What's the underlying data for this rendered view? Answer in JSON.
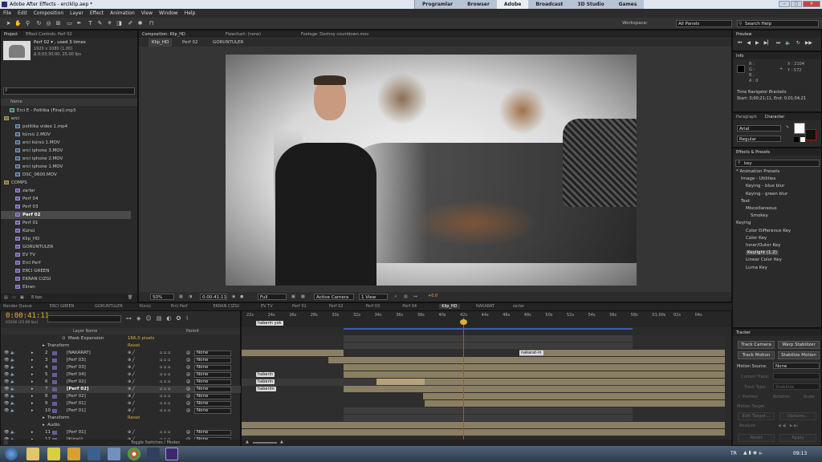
{
  "window": {
    "title": "Adobe After Effects - erciklip.aep *"
  },
  "topnav": [
    "Programlar",
    "Browser",
    "Adobe",
    "Broadcast",
    "3D Studio",
    "Games"
  ],
  "topnav_active": "Adobe",
  "menu": [
    "File",
    "Edit",
    "Composition",
    "Layer",
    "Effect",
    "Animation",
    "View",
    "Window",
    "Help"
  ],
  "toolbar": {
    "workspace_label": "Workspace:",
    "workspace_value": "All Panels",
    "search_placeholder": "Search Help"
  },
  "project": {
    "tabs": [
      "Project",
      "Effect Controls: Perf 02"
    ],
    "item_name": "Perf 02 ▾ , used 3 times",
    "item_info1": "1920 x 1080 (1,00)",
    "item_info2": "Δ 0;03;30;00, 25,00 fps",
    "col_name": "Name",
    "items": [
      {
        "label": "Erci E - Politika (Final).mp3",
        "type": "aud",
        "indent": 1
      },
      {
        "label": "erci",
        "type": "folder",
        "indent": 0
      },
      {
        "label": "politika video 1.mp4",
        "type": "vid",
        "indent": 2
      },
      {
        "label": "kürsü 2.MOV",
        "type": "vid",
        "indent": 2
      },
      {
        "label": "erci kürsü 1.MOV",
        "type": "vid",
        "indent": 2
      },
      {
        "label": "erci iphone 3.MOV",
        "type": "vid",
        "indent": 2
      },
      {
        "label": "erci iphone 2.MOV",
        "type": "vid",
        "indent": 2
      },
      {
        "label": "erci iphone 1.MOV",
        "type": "vid",
        "indent": 2
      },
      {
        "label": "DSC_0600.MOV",
        "type": "vid",
        "indent": 2
      },
      {
        "label": "COMPS",
        "type": "folder",
        "indent": 0
      },
      {
        "label": "zarlar",
        "type": "comp",
        "indent": 2
      },
      {
        "label": "Perf 04",
        "type": "comp",
        "indent": 2
      },
      {
        "label": "Perf 03",
        "type": "comp",
        "indent": 2
      },
      {
        "label": "Perf 02",
        "type": "comp",
        "indent": 2,
        "selected": true
      },
      {
        "label": "Perf 01",
        "type": "comp",
        "indent": 2
      },
      {
        "label": "Kürsü",
        "type": "comp",
        "indent": 2
      },
      {
        "label": "Klip_HD",
        "type": "comp",
        "indent": 2
      },
      {
        "label": "GORUNTULER",
        "type": "comp",
        "indent": 2
      },
      {
        "label": "EV TV",
        "type": "comp",
        "indent": 2
      },
      {
        "label": "Erci Perf",
        "type": "comp",
        "indent": 2
      },
      {
        "label": "ERCI GREEN",
        "type": "comp",
        "indent": 2
      },
      {
        "label": "EKRAN CIZGI",
        "type": "comp",
        "indent": 2
      },
      {
        "label": "Ekran",
        "type": "comp",
        "indent": 2
      }
    ],
    "bpc": "8 bpc"
  },
  "composition": {
    "tabs": [
      "Composition: Klip_HD",
      "Flowchart: (none)",
      "Footage: Destroy countdown.mov"
    ],
    "breadcrumbs": [
      "Klip_HD",
      "Perf 02",
      "GORUNTULER"
    ],
    "footer": {
      "zoom": "50%",
      "timecode": "0:00:41:11",
      "resolution": "Full",
      "camera": "Active Camera",
      "views": "1 View",
      "exposure": "+0,0"
    }
  },
  "info": {
    "tab": "Info",
    "r": "R :",
    "g": "G :",
    "b": "B :",
    "a": "A : 0",
    "x": "X : 2104",
    "y": "Y : 572",
    "tnb_label": "Time Navigator Brackets",
    "tnb_value": "Start: 0;00;21;11, End: 0;01;04;21"
  },
  "preview": {
    "tab": "Preview"
  },
  "character": {
    "tabs": [
      "Paragraph",
      "Character"
    ],
    "font": "Arial",
    "style": "Regular"
  },
  "effects": {
    "tab": "Effects & Presets",
    "search": "key",
    "items": [
      {
        "label": "* Animation Presets",
        "indent": 0
      },
      {
        "label": "Image - Utilities",
        "indent": 1
      },
      {
        "label": "Keying - blue blur",
        "indent": 2
      },
      {
        "label": "Keying - green blur",
        "indent": 2
      },
      {
        "label": "Text",
        "indent": 1
      },
      {
        "label": "Miscellaneous",
        "indent": 2
      },
      {
        "label": "Smokey",
        "indent": 3
      },
      {
        "label": "Keying",
        "indent": 0
      },
      {
        "label": "Color Difference Key",
        "indent": 2
      },
      {
        "label": "Color Key",
        "indent": 2
      },
      {
        "label": "Inner/Outer Key",
        "indent": 2
      },
      {
        "label": "Keylight (1.2)",
        "indent": 2,
        "selected": true
      },
      {
        "label": "Linear Color Key",
        "indent": 2
      },
      {
        "label": "Luma Key",
        "indent": 2
      }
    ]
  },
  "tracker": {
    "tab": "Tracker",
    "track_camera": "Track Camera",
    "warp_stabilizer": "Warp Stabilizer",
    "track_motion": "Track Motion",
    "stabilize_motion": "Stabilize Motion",
    "motion_source_label": "Motion Source:",
    "motion_source": "None",
    "current_track": "Current Track:",
    "track_type": "Track Type:",
    "track_type_value": "Stabilize",
    "position": "✓ Position",
    "rotation": "Rotation",
    "scale": "Scale",
    "motion_target": "Motion Target:",
    "edit_target": "Edit Target...",
    "options": "Options...",
    "analyze": "Analyze:",
    "reset": "Reset",
    "apply": "Apply"
  },
  "timeline": {
    "tabs": [
      "Render Queue",
      "ERCI GREEN",
      "GORUNTULER",
      "Kürsü",
      "Erci Perf",
      "EKRAN CIZGI",
      "EV TV",
      "Perf 01",
      "Perf 02",
      "Perf 03",
      "Perf 04",
      "Klip_HD",
      "NAKARAT",
      "zarlar"
    ],
    "active_tab": "Klip_HD",
    "timecode": "0:00:41:11",
    "timecode_sub": "01036 (25.00 fps)",
    "col_layer": "Layer Name",
    "col_parent": "Parent",
    "mask_expansion_label": "Mask Expansion",
    "mask_expansion_value": "166,0 pixels",
    "transform": "Transform",
    "reset": "Reset",
    "audio": "Audio",
    "toggle": "Toggle Switches / Modes",
    "ruler": [
      "22s",
      "24s",
      "26s",
      "28s",
      "30s",
      "32s",
      "34s",
      "36s",
      "38s",
      "40s",
      "42s",
      "44s",
      "46s",
      "48s",
      "50s",
      "52s",
      "54s",
      "56s",
      "58s",
      "01:00s",
      "02s",
      "04s"
    ],
    "layers": [
      {
        "num": "2",
        "name": "[NAKARAT]",
        "parent": "None"
      },
      {
        "num": "3",
        "name": "[Perf 03]",
        "parent": "None"
      },
      {
        "num": "4",
        "name": "[Perf 03]",
        "parent": "None"
      },
      {
        "num": "5",
        "name": "[Perf 04]",
        "parent": "None"
      },
      {
        "num": "6",
        "name": "[Perf 02]",
        "parent": "None"
      },
      {
        "num": "7",
        "name": "[Perf 02]",
        "parent": "None",
        "selected": true
      },
      {
        "num": "8",
        "name": "[Perf 02]",
        "parent": "None"
      },
      {
        "num": "9",
        "name": "[Perf 01]",
        "parent": "None"
      },
      {
        "num": "10",
        "name": "[Perf 01]",
        "parent": "None"
      },
      {
        "num": "11",
        "name": "[Perf 01]",
        "parent": "None"
      },
      {
        "num": "12",
        "name": "[Kürsü]",
        "parent": "None"
      }
    ],
    "markers": [
      "haberin yok",
      "nakarat-in",
      "haberin",
      "haberin",
      "haberim"
    ]
  },
  "taskbar": {
    "lang": "TR",
    "clock": "09:13"
  }
}
